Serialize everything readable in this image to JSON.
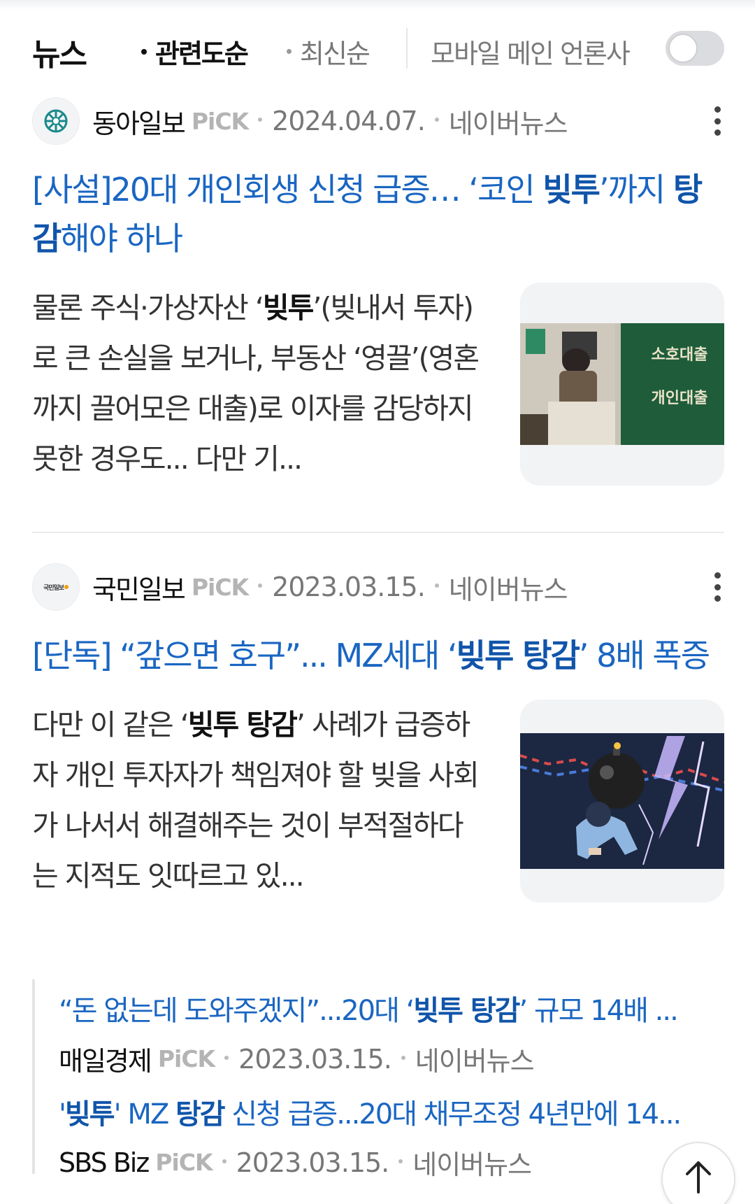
{
  "header": {
    "title": "뉴스",
    "sort_relevance": "관련도순",
    "sort_latest": "최신순",
    "toggle_label": "모바일 메인 언론사",
    "toggle_on": false
  },
  "articles": [
    {
      "source": "동아일보",
      "pick": "PiCK",
      "date": "2024.04.07.",
      "platform": "네이버뉴스",
      "title": {
        "p1": "[사설]20대 개인회생 신청 급증… ‘코인 ",
        "b1": "빚투",
        "p2": "’까지 ",
        "b2": "탕감",
        "p3": "해야 하나"
      },
      "desc": {
        "p1": "물론 주식·가상자산 ‘",
        "b1": "빚투",
        "p2": "’(빚내서 투자)로 큰 손실을 보거나, 부동산 ‘영끌’(영혼까지 끌어모은 대출)로 이자를 감당하지 못한 경우도... 다만 기..."
      },
      "thumb_sign_1": "소호대출",
      "thumb_sign_2": "개인대출"
    },
    {
      "source": "국민일보",
      "logo_text": "국민일보",
      "pick": "PiCK",
      "date": "2023.03.15.",
      "platform": "네이버뉴스",
      "title": {
        "p1": "[단독] “갚으면 호구”... MZ세대 ‘",
        "b1": "빚투 탕감",
        "p2": "’ 8배 폭증"
      },
      "desc": {
        "p1": "다만 이 같은 ‘",
        "b1": "빚투 탕감",
        "p2": "’ 사례가 급증하자 개인 투자자가 책임져야 할 빚을 사회가 나서서 해결해주는 것이 부적절하다는 지적도 잇따르고 있..."
      }
    }
  ],
  "related": [
    {
      "title": {
        "p1": "“돈 없는데 도와주겠지”...20대 ‘",
        "b1": "빚투 탕감",
        "p2": "’ 규모 14배 ..."
      },
      "source": "매일경제",
      "pick": "PiCK",
      "date": "2023.03.15.",
      "platform": "네이버뉴스"
    },
    {
      "title": {
        "p1": "'",
        "b1": "빚투",
        "p2": "' MZ ",
        "b2": "탕감",
        "p3": " 신청 급증...20대 채무조정 4년만에 14..."
      },
      "source": "SBS Biz",
      "pick": "PiCK",
      "date": "2023.03.15.",
      "platform": "네이버뉴스"
    }
  ],
  "colors": {
    "link": "#1a66c2",
    "toggle_off": "#dadce0",
    "thumb_green": "#1e5c3a"
  },
  "icons": [
    "donga-logo-icon",
    "more-vertical-icon",
    "kukmin-logo-icon",
    "arrow-up-icon"
  ]
}
